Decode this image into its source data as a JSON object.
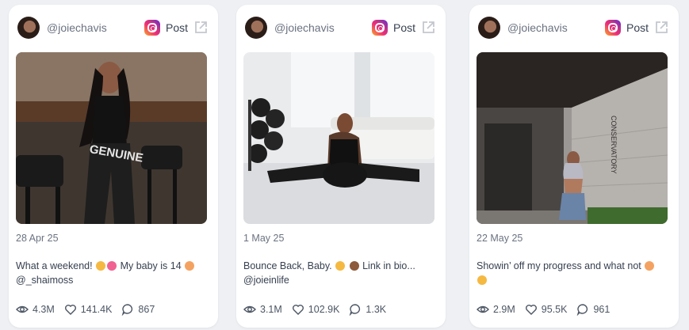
{
  "posts": [
    {
      "handle": "@joiechavis",
      "post_label": "Post",
      "date": "28 Apr 25",
      "caption_a": "What a weekend!",
      "caption_b": "My baby is 14",
      "caption_c": "@_shaimoss",
      "views": "4.3M",
      "likes": "141.4K",
      "comments": "867"
    },
    {
      "handle": "@joiechavis",
      "post_label": "Post",
      "date": "1 May 25",
      "caption_a": "Bounce Back, Baby.",
      "caption_b": "Link in bio...",
      "caption_c": "@joieinlife",
      "views": "3.1M",
      "likes": "102.9K",
      "comments": "1.3K"
    },
    {
      "handle": "@joiechavis",
      "post_label": "Post",
      "date": "22 May 25",
      "caption_a": "Showin’ off my progress and what not",
      "caption_b": "",
      "caption_c": "",
      "views": "2.9M",
      "likes": "95.5K",
      "comments": "961"
    }
  ],
  "icons": {
    "platform": "instagram-icon",
    "external": "external-link-icon",
    "views": "eye-icon",
    "likes": "heart-icon",
    "comments": "comment-icon"
  }
}
